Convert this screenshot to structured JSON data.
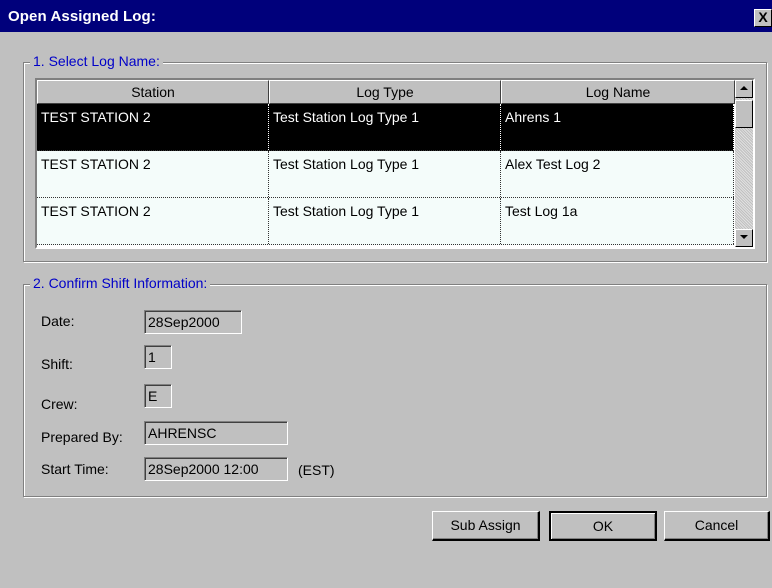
{
  "window": {
    "title": "Open Assigned Log:",
    "close_label": "X"
  },
  "section1": {
    "legend": "1. Select Log Name:",
    "columns": [
      "Station",
      "Log Type",
      "Log Name"
    ],
    "rows": [
      [
        "TEST STATION 2",
        "Test Station Log Type 1",
        "Ahrens 1"
      ],
      [
        "TEST STATION 2",
        "Test Station Log Type 1",
        "Alex Test  Log 2"
      ],
      [
        "TEST STATION 2",
        "Test Station Log Type 1",
        "Test Log 1a"
      ]
    ],
    "selected_row": 0,
    "scroll_up_icon": "arrow-up-icon",
    "scroll_down_icon": "arrow-down-icon"
  },
  "section2": {
    "legend": "2. Confirm Shift Information:",
    "date_label": "Date:",
    "date_value": "28Sep2000",
    "shift_label": "Shift:",
    "shift_value": "1",
    "crew_label": "Crew:",
    "crew_value": "E",
    "prepared_label": "Prepared By:",
    "prepared_value": "AHRENSC",
    "start_label": "Start Time:",
    "start_value": "28Sep2000 12:00",
    "timezone": "(EST)"
  },
  "buttons": {
    "sub_assign": "Sub Assign",
    "ok": "OK",
    "cancel": "Cancel"
  },
  "colors": {
    "titlebar": "#00007b",
    "legend_text": "#0000c8",
    "face": "#c0c0c0"
  }
}
